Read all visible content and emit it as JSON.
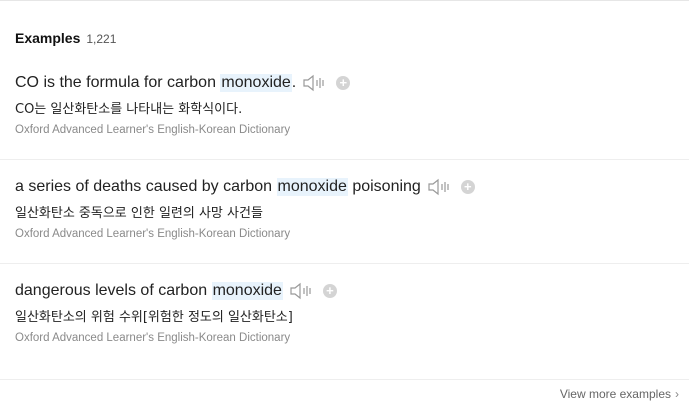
{
  "header": {
    "title": "Examples",
    "count": "1,221"
  },
  "examples": [
    {
      "en_before": "CO is the formula for carbon ",
      "en_highlight": "monoxide",
      "en_after": ".",
      "ko": "CO는 일산화탄소를 나타내는 화학식이다.",
      "source": "Oxford Advanced Learner's English-Korean Dictionary"
    },
    {
      "en_before": "a series of deaths caused by carbon ",
      "en_highlight": "monoxide",
      "en_after": " poisoning",
      "ko": "일산화탄소 중독으로 인한 일련의 사망 사건들",
      "source": "Oxford Advanced Learner's English-Korean Dictionary"
    },
    {
      "en_before": "dangerous levels of carbon ",
      "en_highlight": "monoxide",
      "en_after": "",
      "ko": "일산화탄소의 위험 수위[위험한 정도의 일산화탄소]",
      "source": "Oxford Advanced Learner's English-Korean Dictionary"
    }
  ],
  "footer": {
    "more_label": "View more examples",
    "chevron": "›"
  },
  "icons": {
    "speaker": "speaker-icon",
    "add": "plus-icon"
  },
  "colors": {
    "highlight": "#e8f3fc",
    "icon": "#999999"
  }
}
